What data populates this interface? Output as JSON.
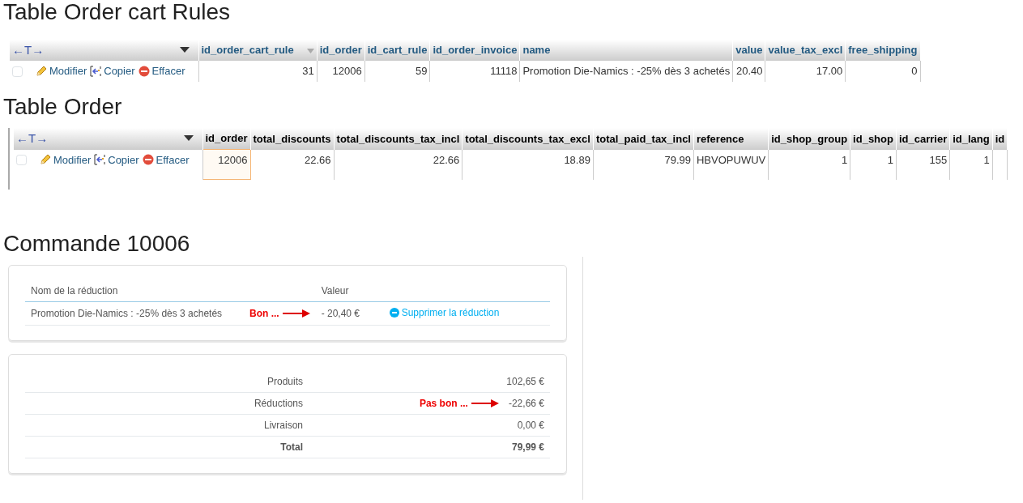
{
  "cart_rules_table": {
    "title": "Table Order cart Rules",
    "header_links": true,
    "toggle_label": "←T→",
    "columns": [
      {
        "label": "id_order_cart_rule",
        "kind": "number",
        "sorted": true
      },
      {
        "label": "id_order",
        "kind": "number",
        "sorted": false
      },
      {
        "label": "id_cart_rule",
        "kind": "number",
        "sorted": false
      },
      {
        "label": "id_order_invoice",
        "kind": "number",
        "sorted": false
      },
      {
        "label": "name",
        "kind": "text",
        "sorted": false
      },
      {
        "label": "value",
        "kind": "number",
        "sorted": false
      },
      {
        "label": "value_tax_excl",
        "kind": "number",
        "sorted": false
      },
      {
        "label": "free_shipping",
        "kind": "number",
        "sorted": false
      }
    ],
    "rows": [
      {
        "checked": false,
        "actions": [
          {
            "kind": "edit",
            "label": "Modifier"
          },
          {
            "kind": "copy",
            "label": "Copier"
          },
          {
            "kind": "delete",
            "label": "Effacer"
          }
        ],
        "cells": [
          {
            "text": "31",
            "focused": false
          },
          {
            "text": "12006",
            "focused": false
          },
          {
            "text": "59",
            "focused": false
          },
          {
            "text": "11118",
            "focused": false
          },
          {
            "text": "Promotion Die-Namics : -25% dès 3 achetés",
            "focused": false
          },
          {
            "text": "20.40",
            "focused": false
          },
          {
            "text": "17.00",
            "focused": false
          },
          {
            "text": "0",
            "focused": false
          }
        ]
      }
    ]
  },
  "order_table": {
    "title": "Table Order",
    "header_links": false,
    "toggle_label": "←T→",
    "columns": [
      {
        "label": "id_order",
        "kind": "number",
        "sorted": false
      },
      {
        "label": "total_discounts",
        "kind": "number",
        "sorted": false
      },
      {
        "label": "total_discounts_tax_incl",
        "kind": "number",
        "sorted": false
      },
      {
        "label": "total_discounts_tax_excl",
        "kind": "number",
        "sorted": false
      },
      {
        "label": "total_paid_tax_incl",
        "kind": "number",
        "sorted": false
      },
      {
        "label": "reference",
        "kind": "text",
        "sorted": false
      },
      {
        "label": "id_shop_group",
        "kind": "number",
        "sorted": false
      },
      {
        "label": "id_shop",
        "kind": "number",
        "sorted": false
      },
      {
        "label": "id_carrier",
        "kind": "number",
        "sorted": false
      },
      {
        "label": "id_lang",
        "kind": "number",
        "sorted": false
      },
      {
        "label": "id",
        "kind": "number",
        "sorted": false
      }
    ],
    "rows": [
      {
        "checked": false,
        "actions": [
          {
            "kind": "edit",
            "label": "Modifier"
          },
          {
            "kind": "copy",
            "label": "Copier"
          },
          {
            "kind": "delete",
            "label": "Effacer"
          }
        ],
        "cells": [
          {
            "text": "12006",
            "focused": true
          },
          {
            "text": "22.66",
            "focused": false
          },
          {
            "text": "22.66",
            "focused": false
          },
          {
            "text": "18.89",
            "focused": false
          },
          {
            "text": "79.99",
            "focused": false
          },
          {
            "text": "HBVOPUWUV",
            "focused": false
          },
          {
            "text": "1",
            "focused": false
          },
          {
            "text": "1",
            "focused": false
          },
          {
            "text": "155",
            "focused": false
          },
          {
            "text": "1",
            "focused": false
          }
        ]
      }
    ]
  },
  "order": {
    "title": "Commande 10006",
    "discounts": {
      "columns": [
        "Nom de la réduction",
        "Valeur"
      ],
      "rows": [
        {
          "name": "Promotion Die-Namics : -25% dès 3 achetés",
          "note": "Bon ...",
          "value": "- 20,40 €",
          "action": "Supprimer la réduction"
        }
      ]
    },
    "totals": [
      {
        "label": "Produits",
        "value": "102,65 €",
        "bold": false
      },
      {
        "label": "Réductions",
        "value": "-22,66 €",
        "note": "Pas bon ...",
        "bold": false
      },
      {
        "label": "Livraison",
        "value": "0,00 €",
        "bold": false
      },
      {
        "label": "Total",
        "value": "79,99 €",
        "bold": true
      }
    ]
  }
}
